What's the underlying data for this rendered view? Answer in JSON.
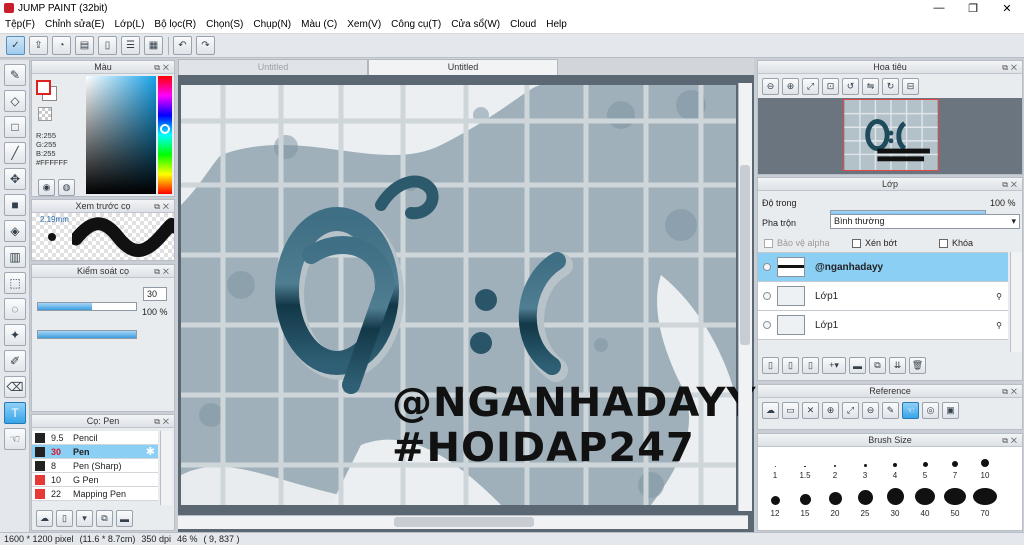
{
  "window": {
    "title": "JUMP PAINT (32bit)",
    "min": "—",
    "max": "❐",
    "close": "✕"
  },
  "menu": [
    "Tệp(F)",
    "Chỉnh sửa(E)",
    "Lớp(L)",
    "Bộ lọc(R)",
    "Chọn(S)",
    "Chụp(N)",
    "Màu (C)",
    "Xem(V)",
    "Công cụ(T)",
    "Cửa sổ(W)",
    "Cloud",
    "Help"
  ],
  "tabs": [
    {
      "label": "Untitled"
    },
    {
      "label": "Untitled"
    }
  ],
  "color_panel": {
    "title": "Màu",
    "r": "R:255",
    "g": "G:255",
    "b": "B:255",
    "hex": "#FFFFFF",
    "primary": "#ffffff",
    "secondary": "#ffffff"
  },
  "brush_preview": {
    "title": "Xem trước cọ",
    "size": "2.19mm"
  },
  "brush_control": {
    "title": "Kiểm soát cọ",
    "size_value": "30",
    "opacity_value": "100 %",
    "opacity": 1.0,
    "size_fill": 0.55
  },
  "brush_list": {
    "title": "Cọ: Pen",
    "items": [
      {
        "size": "9.5",
        "name": "Pencil",
        "color": "#222222"
      },
      {
        "size": "30",
        "name": "Pen",
        "color": "#222222"
      },
      {
        "size": "8",
        "name": "Pen (Sharp)",
        "color": "#222222"
      },
      {
        "size": "10",
        "name": "G Pen",
        "color": "#e53935"
      },
      {
        "size": "22",
        "name": "Mapping Pen",
        "color": "#e53935"
      }
    ]
  },
  "artwork": {
    "watermark_line1": "@NGANHADAYY",
    "watermark_line2": "#HOIDAP247",
    "face_text": "Ơ:("
  },
  "navigator": {
    "title": "Hoa tiêu"
  },
  "layers": {
    "title": "Lớp",
    "opacity_label": "Độ trong",
    "opacity_value": "100 %",
    "blend_label": "Pha trộn",
    "blend_value": "Bình thường",
    "protect_alpha": "Bảo vệ alpha",
    "clipping": "Xén bớt",
    "lock": "Khóa",
    "items": [
      {
        "name": "@nganhadayy"
      },
      {
        "name": "Lớp1"
      },
      {
        "name": "Lớp1"
      }
    ]
  },
  "reference": {
    "title": "Reference"
  },
  "brush_size": {
    "title": "Brush Size",
    "row1": [
      "1",
      "1.5",
      "2",
      "3",
      "4",
      "5",
      "7",
      "10"
    ],
    "row2": [
      "12",
      "15",
      "20",
      "25",
      "30",
      "40",
      "50",
      "70"
    ]
  },
  "status": {
    "pixels": "1600 * 1200 pixel",
    "cm": "(11.6 * 8.7cm)",
    "dpi": "350 dpi",
    "zoom": "46 %",
    "coords": "( 9, 837 )"
  }
}
